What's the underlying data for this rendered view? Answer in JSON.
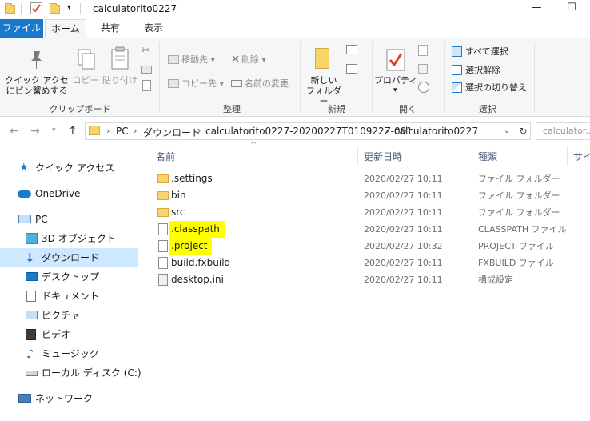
{
  "window": {
    "title": "calculatorito0227",
    "minimize": "—",
    "maximize": "☐"
  },
  "tabs": {
    "file": "ファイル",
    "home": "ホーム",
    "share": "共有",
    "view": "表示"
  },
  "ribbon": {
    "clipboard": {
      "label": "クリップボード",
      "pin_line1": "クイック アクセス",
      "pin_line2": "にピン留めする",
      "copy": "コピー",
      "paste": "貼り付け"
    },
    "organize": {
      "label": "整理",
      "move_to": "移動先",
      "copy_to": "コピー先",
      "delete": "削除",
      "rename": "名前の変更"
    },
    "new": {
      "label": "新規",
      "new_folder_line1": "新しい",
      "new_folder_line2": "フォルダー"
    },
    "open": {
      "label": "開く",
      "properties": "プロパティ"
    },
    "select": {
      "label": "選択",
      "select_all": "すべて選択",
      "select_none": "選択解除",
      "invert": "選択の切り替え"
    }
  },
  "address": {
    "crumbs": [
      "PC",
      "ダウンロード",
      "calculatorito0227-20200227T010922Z-001",
      "calculatorito0227"
    ],
    "search_placeholder": "calculator..."
  },
  "nav": {
    "items": [
      {
        "label": "クイック アクセス",
        "icon": "star-icon"
      },
      {
        "label": "OneDrive",
        "icon": "cloud-icon"
      },
      {
        "label": "PC",
        "icon": "pc-icon"
      },
      {
        "label": "3D オブジェクト",
        "icon": "cube-icon"
      },
      {
        "label": "ダウンロード",
        "icon": "download-icon"
      },
      {
        "label": "デスクトップ",
        "icon": "desktop-icon"
      },
      {
        "label": "ドキュメント",
        "icon": "document-icon"
      },
      {
        "label": "ピクチャ",
        "icon": "picture-icon"
      },
      {
        "label": "ビデオ",
        "icon": "video-icon"
      },
      {
        "label": "ミュージック",
        "icon": "music-icon"
      },
      {
        "label": "ローカル ディスク (C:)",
        "icon": "disk-icon"
      },
      {
        "label": "ネットワーク",
        "icon": "network-icon"
      }
    ]
  },
  "columns": {
    "name": "名前",
    "date": "更新日時",
    "type": "種類",
    "size": "サイ"
  },
  "files": [
    {
      "name": ".settings",
      "date": "2020/02/27 10:11",
      "type": "ファイル フォルダー",
      "icon": "folder-icon",
      "highlight": false
    },
    {
      "name": "bin",
      "date": "2020/02/27 10:11",
      "type": "ファイル フォルダー",
      "icon": "folder-icon",
      "highlight": false
    },
    {
      "name": "src",
      "date": "2020/02/27 10:11",
      "type": "ファイル フォルダー",
      "icon": "folder-icon",
      "highlight": false
    },
    {
      "name": ".classpath",
      "date": "2020/02/27 10:11",
      "type": "CLASSPATH ファイル",
      "icon": "file-icon",
      "highlight": true
    },
    {
      "name": ".project",
      "date": "2020/02/27 10:32",
      "type": "PROJECT ファイル",
      "icon": "file-icon",
      "highlight": true
    },
    {
      "name": "build.fxbuild",
      "date": "2020/02/27 10:11",
      "type": "FXBUILD ファイル",
      "icon": "file-icon",
      "highlight": false
    },
    {
      "name": "desktop.ini",
      "date": "2020/02/27 10:11",
      "type": "構成設定",
      "icon": "settings-file-icon",
      "highlight": false
    }
  ],
  "colors": {
    "accent": "#1979ca",
    "selection": "#cde8ff",
    "highlight": "#ffff00"
  }
}
